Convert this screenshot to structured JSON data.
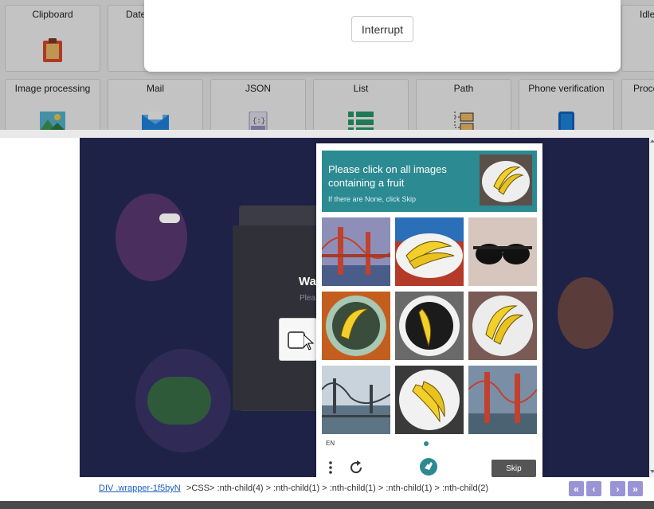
{
  "palette": {
    "tiles_row1": [
      {
        "label": "Clipboard",
        "icon": "clipboard-icon"
      },
      {
        "label": "Date",
        "icon": "calendar-icon"
      },
      {
        "label": "Idle",
        "icon": "idle-icon"
      }
    ],
    "tiles_row2": [
      {
        "label": "Image processing",
        "icon": "image-icon"
      },
      {
        "label": "Mail",
        "icon": "mail-icon"
      },
      {
        "label": "JSON",
        "icon": "json-file-icon"
      },
      {
        "label": "List",
        "icon": "list-icon"
      },
      {
        "label": "Path",
        "icon": "path-icon"
      },
      {
        "label": "Phone verification",
        "icon": "phone-icon"
      },
      {
        "label": "Proce",
        "icon": "process-icon"
      }
    ]
  },
  "modal": {
    "interrupt_label": "Interrupt"
  },
  "preview": {
    "title_fragment": "Wa",
    "subtitle_fragment": "Plea"
  },
  "captcha": {
    "prompt": "Please click on all images containing a fruit",
    "hint": "If there are None, click Skip",
    "language": "EN",
    "skip_label": "Skip",
    "cells": [
      "bridge",
      "banana",
      "sunglasses",
      "banana",
      "banana",
      "banana",
      "bridge",
      "banana",
      "bridge"
    ],
    "accent_color": "#2b8a92"
  },
  "selector": {
    "element_link": "DIV .wrapper-1f5byN",
    "css_path": ">CSS> :nth-child(4) > :nth-child(1) > :nth-child(1) > :nth-child(1) > :nth-child(2)"
  }
}
